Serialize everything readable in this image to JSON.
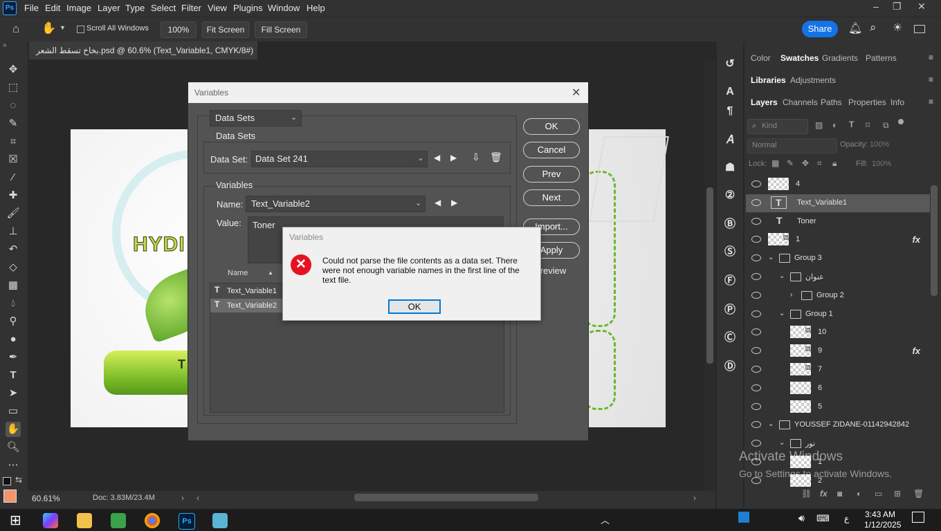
{
  "app": {
    "logo": "Ps"
  },
  "menu": [
    "File",
    "Edit",
    "Image",
    "Layer",
    "Type",
    "Select",
    "Filter",
    "View",
    "Plugins",
    "Window",
    "Help"
  ],
  "options": {
    "scroll_all_windows": "Scroll All Windows",
    "zoom": "100%",
    "fit_screen": "Fit Screen",
    "fill_screen": "Fill Screen",
    "share": "Share"
  },
  "document_tab": {
    "title": "بخاخ تسقط الشعر.psd @ 60.6% (Text_Variable1, CMYK/8#) *",
    "close": "×"
  },
  "status": {
    "zoom": "60.61%",
    "doc": "Doc: 3.83M/23.4M"
  },
  "panels": {
    "tabs_row1": [
      "Color",
      "Swatches",
      "Gradients",
      "Patterns"
    ],
    "tabs_row2": [
      "Libraries",
      "Adjustments"
    ],
    "tabs_row3": [
      "Layers",
      "Channels",
      "Paths",
      "Properties",
      "Info"
    ],
    "kind_placeholder": "Kind",
    "blend_mode": "Normal",
    "opacity_label": "Opacity:",
    "opacity_value": "100%",
    "lock_label": "Lock:",
    "fill_label": "Fill:",
    "fill_value": "100%"
  },
  "layers": [
    {
      "name": "4",
      "type": "pixel",
      "indent": 0
    },
    {
      "name": "Text_Variable1",
      "type": "text",
      "indent": 0,
      "selected": true
    },
    {
      "name": "Toner",
      "type": "text",
      "indent": 0
    },
    {
      "name": "1",
      "type": "smart",
      "indent": 0,
      "fx": "fx"
    },
    {
      "name": "Group 3",
      "type": "group",
      "indent": 0
    },
    {
      "name": "عنوان",
      "type": "group",
      "indent": 1
    },
    {
      "name": "Group 2",
      "type": "group",
      "indent": 2
    },
    {
      "name": "Group 1",
      "type": "group",
      "indent": 1
    },
    {
      "name": "10",
      "type": "smart",
      "indent": 2
    },
    {
      "name": "9",
      "type": "smart",
      "indent": 2,
      "fx": "fx"
    },
    {
      "name": "7",
      "type": "smart",
      "indent": 2
    },
    {
      "name": "6",
      "type": "pixel",
      "indent": 2
    },
    {
      "name": "5",
      "type": "pixel",
      "indent": 2
    },
    {
      "name": "YOUSSEF ZIDANE-01142942842",
      "type": "group",
      "indent": 0
    },
    {
      "name": "نور",
      "type": "group",
      "indent": 1
    },
    {
      "name": "1",
      "type": "pixel",
      "indent": 2
    },
    {
      "name": "2",
      "type": "pixel",
      "indent": 2
    }
  ],
  "watermark": {
    "line1": "Activate Windows",
    "line2": "Go to Settings to activate Windows."
  },
  "artboard": {
    "label1": "HYDI",
    "label2": "T"
  },
  "variables_dialog": {
    "title": "Variables",
    "section_select": "Data Sets",
    "datasets_label": "Data Sets",
    "dataset_label": "Data Set:",
    "dataset_value": "Data Set 241",
    "variables_label": "Variables",
    "name_label": "Name:",
    "name_value": "Text_Variable2",
    "value_label": "Value:",
    "value_text": "Toner",
    "list_header": "Name",
    "list_items": [
      "Text_Variable1",
      "Text_Variable2"
    ],
    "buttons": {
      "ok": "OK",
      "cancel": "Cancel",
      "prev": "Prev",
      "next": "Next",
      "import": "Import...",
      "apply": "Apply",
      "preview": "Preview"
    }
  },
  "error_dialog": {
    "title": "Variables",
    "message": "Could not parse the file contents as a data set. There were not enough variable names in the first line of the text file.",
    "ok": "OK"
  },
  "taskbar": {
    "time": "3:43 AM",
    "date": "1/12/2025",
    "lang": "ع"
  },
  "colors": {
    "accent": "#1473e6",
    "error": "#e81123",
    "leaf_green": "#6ab82e"
  }
}
